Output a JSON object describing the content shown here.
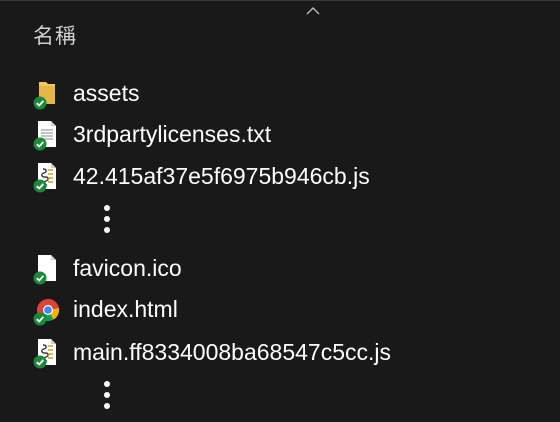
{
  "header": {
    "name_column": "名稱"
  },
  "files": [
    {
      "name": "assets",
      "icon": "folder-icon",
      "status": "synced"
    },
    {
      "name": "3rdpartylicenses.txt",
      "icon": "text-file-icon",
      "status": "synced"
    },
    {
      "name": "42.415af37e5f6975b946cb.js",
      "icon": "script-file-icon",
      "status": "synced"
    },
    {
      "name": "favicon.ico",
      "icon": "generic-file-icon",
      "status": "synced"
    },
    {
      "name": "index.html",
      "icon": "chrome-html-icon",
      "status": "synced"
    },
    {
      "name": "main.ff8334008ba68547c5cc.js",
      "icon": "script-file-icon",
      "status": "synced"
    }
  ],
  "colors": {
    "background": "#191919",
    "sync_green": "#1a8a3a",
    "folder": "#f2c75c"
  }
}
